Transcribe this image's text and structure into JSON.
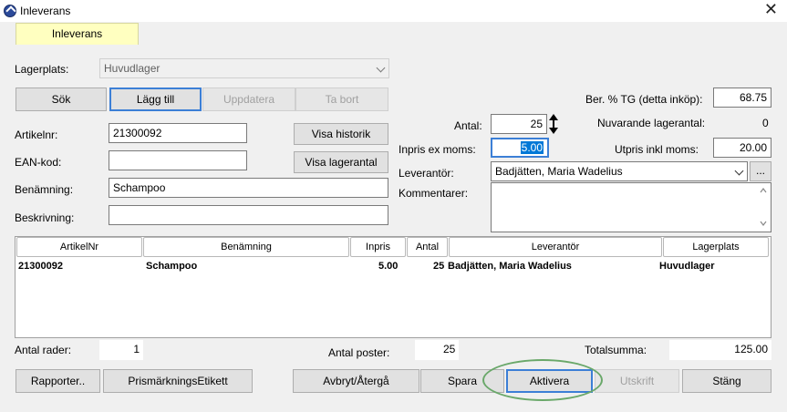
{
  "window": {
    "title": "Inleverans",
    "close_symbol": "✕"
  },
  "tab": {
    "label": "Inleverans"
  },
  "lagerplats": {
    "label": "Lagerplats:",
    "value": "Huvudlager"
  },
  "toolbar": {
    "sok": "Sök",
    "lagg_till": "Lägg till",
    "uppdatera": "Uppdatera",
    "ta_bort": "Ta bort"
  },
  "form": {
    "artikelnr_label": "Artikelnr:",
    "artikelnr_value": "21300092",
    "ean_label": "EAN-kod:",
    "ean_value": "",
    "benamning_label": "Benämning:",
    "benamning_value": "Schampoo",
    "beskrivning_label": "Beskrivning:",
    "beskrivning_value": "",
    "visa_historik": "Visa historik",
    "visa_lagerantal": "Visa lagerantal",
    "antal_label": "Antal:",
    "antal_value": "25",
    "inpris_label": "Inpris ex moms:",
    "inpris_value": "5.00",
    "leverantor_label": "Leverantör:",
    "leverantor_value": "Badjätten, Maria Wadelius",
    "leverantor_more": "...",
    "kommentarer_label": "Kommentarer:",
    "kommentarer_value": "",
    "ber_tg_label": "Ber. % TG (detta inköp):",
    "ber_tg_value": "68.75",
    "nuvarande_label": "Nuvarande lagerantal:",
    "nuvarande_value": "0",
    "utpris_label": "Utpris inkl moms:",
    "utpris_value": "20.00"
  },
  "grid": {
    "headers": [
      "ArtikelNr",
      "Benämning",
      "Inpris",
      "Antal",
      "Leverantör",
      "Lagerplats"
    ],
    "rows": [
      {
        "artikelnr": "21300092",
        "benamning": "Schampoo",
        "inpris": "5.00",
        "antal": "25",
        "leverantor": "Badjätten, Maria Wadelius",
        "lagerplats": "Huvudlager"
      }
    ]
  },
  "summary": {
    "antal_rader_label": "Antal rader:",
    "antal_rader_value": "1",
    "antal_poster_label": "Antal poster:",
    "antal_poster_value": "25",
    "totalsumma_label": "Totalsumma:",
    "totalsumma_value": "125.00"
  },
  "bottom": {
    "rapporter": "Rapporter..",
    "prismarkning": "PrismärkningsEtikett",
    "avbryt": "Avbryt/Återgå",
    "spara": "Spara",
    "aktivera": "Aktivera",
    "utskrift": "Utskrift",
    "stang": "Stäng"
  },
  "colors": {
    "tab_bg": "#ffffc0",
    "focus_blue": "#3c7fd6",
    "highlight_ellipse": "#6aa86a",
    "selected_text_bg": "#0078d7"
  }
}
